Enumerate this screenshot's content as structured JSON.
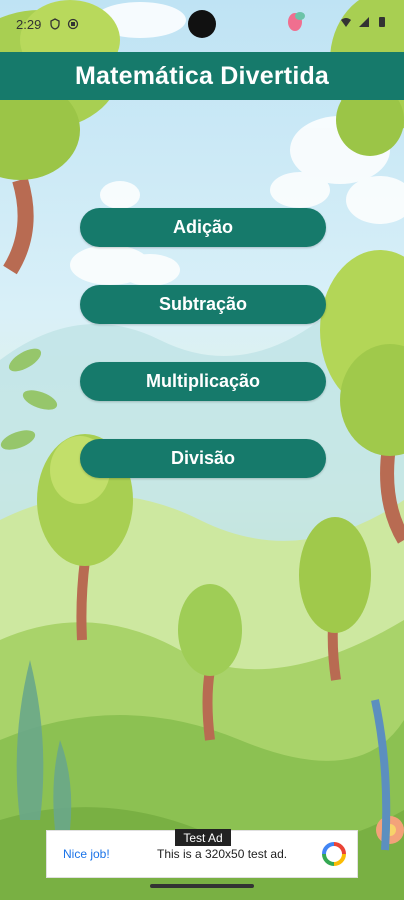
{
  "status_bar": {
    "time": "2:29",
    "icons_left": [
      "shield-icon",
      "sim-icon"
    ],
    "icons_right": [
      "wifi-icon",
      "signal-icon",
      "battery-icon"
    ]
  },
  "header": {
    "title": "Matemática Divertida",
    "color": "#167a6b"
  },
  "menu": {
    "items": [
      {
        "label": "Adição"
      },
      {
        "label": "Subtração"
      },
      {
        "label": "Multiplicação"
      },
      {
        "label": "Divisão"
      }
    ]
  },
  "ad": {
    "label": "Test Ad",
    "nice": "Nice job!",
    "text": "This is a 320x50 test ad."
  }
}
